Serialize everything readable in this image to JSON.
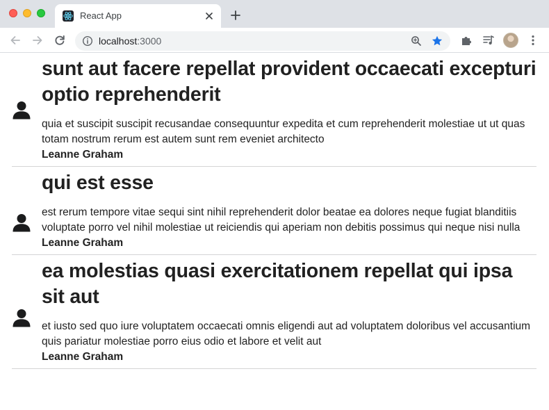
{
  "browser": {
    "tab_title": "React App",
    "url_host": "localhost",
    "url_port": ":3000"
  },
  "icons": {
    "close": "close-icon",
    "new_tab": "plus-icon",
    "back": "back-arrow-icon",
    "forward": "forward-arrow-icon",
    "reload": "reload-icon",
    "info": "info-icon",
    "zoom": "zoom-icon",
    "bookmark": "star-icon",
    "extensions": "puzzle-icon",
    "media": "media-queue-icon",
    "menu": "kebab-menu-icon",
    "post": "user-icon"
  },
  "colors": {
    "tabstrip": "#dee1e6",
    "star": "#1a73e8",
    "title": "#212121",
    "divider": "#d4d4d5"
  },
  "posts": [
    {
      "title": "sunt aut facere repellat provident occaecati excepturi optio reprehenderit",
      "body": "quia et suscipit suscipit recusandae consequuntur expedita et cum reprehenderit molestiae ut ut quas totam nostrum rerum est autem sunt rem eveniet architecto",
      "author": "Leanne Graham"
    },
    {
      "title": "qui est esse",
      "body": "est rerum tempore vitae sequi sint nihil reprehenderit dolor beatae ea dolores neque fugiat blanditiis voluptate porro vel nihil molestiae ut reiciendis qui aperiam non debitis possimus qui neque nisi nulla",
      "author": "Leanne Graham"
    },
    {
      "title": "ea molestias quasi exercitationem repellat qui ipsa sit aut",
      "body": "et iusto sed quo iure voluptatem occaecati omnis eligendi aut ad voluptatem doloribus vel accusantium quis pariatur molestiae porro eius odio et labore et velit aut",
      "author": "Leanne Graham"
    }
  ]
}
